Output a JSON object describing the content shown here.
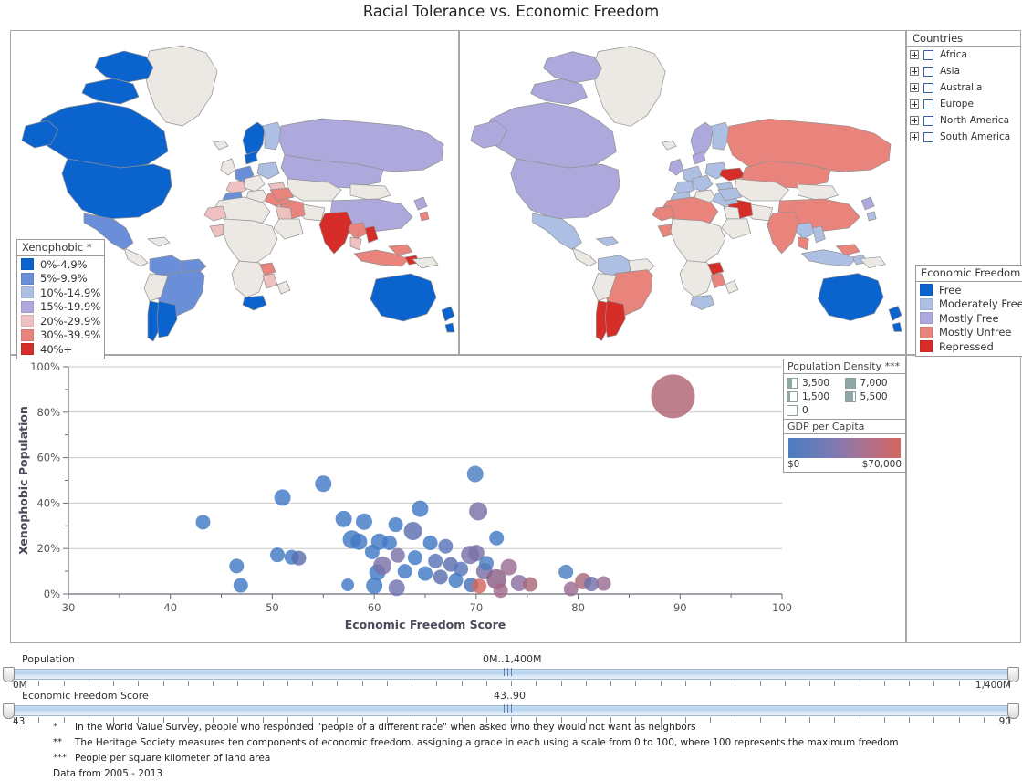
{
  "title": "Racial Tolerance vs. Economic Freedom",
  "countries_panel": {
    "header": "Countries",
    "items": [
      {
        "label": "Africa",
        "expander": "+",
        "checked": false
      },
      {
        "label": "Asia",
        "expander": "+",
        "checked": false
      },
      {
        "label": "Australia",
        "expander": "+",
        "checked": false
      },
      {
        "label": "Europe",
        "expander": "+",
        "checked": false
      },
      {
        "label": "North America",
        "expander": "+",
        "checked": false
      },
      {
        "label": "South America",
        "expander": "+",
        "checked": false
      }
    ]
  },
  "legend_xenophobic": {
    "title": "Xenophobic *",
    "items": [
      {
        "label": "0%-4.9%",
        "color": "#0b63ce"
      },
      {
        "label": "5%-9.9%",
        "color": "#6a8fd8"
      },
      {
        "label": "10%-14.9%",
        "color": "#aebfe4"
      },
      {
        "label": "15%-19.9%",
        "color": "#ada9dc"
      },
      {
        "label": "20%-29.9%",
        "color": "#eec0c0"
      },
      {
        "label": "30%-39.9%",
        "color": "#e8847c"
      },
      {
        "label": "40%+",
        "color": "#d62d28"
      }
    ]
  },
  "legend_economic_freedom": {
    "title": "Economic Freedom **",
    "items": [
      {
        "label": "Free",
        "color": "#0b63ce"
      },
      {
        "label": "Moderately Free",
        "color": "#aebfe4"
      },
      {
        "label": "Mostly Free",
        "color": "#ada9dc"
      },
      {
        "label": "Mostly Unfree",
        "color": "#e8847c"
      },
      {
        "label": "Repressed",
        "color": "#d62d28"
      }
    ]
  },
  "legend_population_density": {
    "title": "Population Density ***",
    "items": [
      {
        "label": "3,500",
        "fill": 0.5
      },
      {
        "label": "7,000",
        "fill": 1.0
      },
      {
        "label": "1,500",
        "fill": 0.3
      },
      {
        "label": "5,500",
        "fill": 0.8
      },
      {
        "label": "0",
        "fill": 0.0
      }
    ]
  },
  "legend_gdp": {
    "title": "GDP per Capita",
    "min_label": "$0",
    "max_label": "$70,000",
    "min_color": "#4a7ec0",
    "max_color": "#d4655e"
  },
  "sliders": [
    {
      "name": "Population",
      "value": "0M..1,400M",
      "min": "0M",
      "max": "1,400M"
    },
    {
      "name": "Economic Freedom Score",
      "value": "43..90",
      "min": "43",
      "max": "90"
    }
  ],
  "footnotes": [
    {
      "mark": "*",
      "text": "In the World Value Survey, people who responded \"people of a different race\" when asked who they would not want as neighbors"
    },
    {
      "mark": "**",
      "text": "The Heritage Society measures ten components of economic freedom, assigning a grade in each using a scale from 0 to 100, where 100 represents the maximum freedom"
    },
    {
      "mark": "***",
      "text": "People per square kilometer of land area"
    }
  ],
  "data_note": "Data from 2005 - 2013",
  "chart_data": {
    "type": "scatter",
    "title": "Racial Tolerance vs. Economic Freedom",
    "xlabel": "Economic Freedom Score",
    "ylabel": "Xenophobic Population",
    "xlim": [
      30,
      100
    ],
    "ylim": [
      0,
      1
    ],
    "xticks": [
      30,
      40,
      50,
      60,
      70,
      80,
      90,
      100
    ],
    "yticks": [
      0,
      20,
      40,
      60,
      80,
      100
    ],
    "ytick_labels": [
      "0%",
      "20%",
      "40%",
      "60%",
      "80%",
      "100%"
    ],
    "grid": "horizontal",
    "size_encodes": "Population Density (people per sq km)",
    "color_encodes": "GDP per Capita ($0 - $70,000)",
    "points": [
      {
        "x": 89.3,
        "y": 87.0,
        "r": 24,
        "c": "#b06374"
      },
      {
        "x": 69.9,
        "y": 52.8,
        "r": 9,
        "c": "#4a7ec0"
      },
      {
        "x": 55.0,
        "y": 48.5,
        "r": 9,
        "c": "#4279c4"
      },
      {
        "x": 51.0,
        "y": 42.4,
        "r": 9,
        "c": "#4279c4"
      },
      {
        "x": 70.2,
        "y": 36.4,
        "r": 10,
        "c": "#7a72a8"
      },
      {
        "x": 64.5,
        "y": 37.5,
        "r": 9,
        "c": "#4279c4"
      },
      {
        "x": 43.2,
        "y": 31.6,
        "r": 8,
        "c": "#4279c4"
      },
      {
        "x": 57.0,
        "y": 33.0,
        "r": 9,
        "c": "#4279c4"
      },
      {
        "x": 59.0,
        "y": 31.8,
        "r": 9,
        "c": "#4279c4"
      },
      {
        "x": 62.1,
        "y": 30.5,
        "r": 8,
        "c": "#4279c4"
      },
      {
        "x": 63.8,
        "y": 27.7,
        "r": 10,
        "c": "#5d6fae"
      },
      {
        "x": 72.0,
        "y": 24.6,
        "r": 8,
        "c": "#4279c4"
      },
      {
        "x": 57.8,
        "y": 24.0,
        "r": 10,
        "c": "#4279c4"
      },
      {
        "x": 58.5,
        "y": 23.0,
        "r": 9,
        "c": "#4279c4"
      },
      {
        "x": 60.5,
        "y": 23.0,
        "r": 9,
        "c": "#4279c4"
      },
      {
        "x": 61.5,
        "y": 22.5,
        "r": 8,
        "c": "#4279c4"
      },
      {
        "x": 65.5,
        "y": 22.5,
        "r": 8,
        "c": "#4279c4"
      },
      {
        "x": 67.0,
        "y": 21.0,
        "r": 8,
        "c": "#5875b8"
      },
      {
        "x": 69.4,
        "y": 17.2,
        "r": 10,
        "c": "#7a72a8"
      },
      {
        "x": 50.5,
        "y": 17.2,
        "r": 8,
        "c": "#4279c4"
      },
      {
        "x": 51.9,
        "y": 16.2,
        "r": 8,
        "c": "#4279c4"
      },
      {
        "x": 52.6,
        "y": 15.8,
        "r": 8,
        "c": "#5d6fae"
      },
      {
        "x": 59.8,
        "y": 18.5,
        "r": 8,
        "c": "#4279c4"
      },
      {
        "x": 62.3,
        "y": 17.0,
        "r": 8,
        "c": "#7a72a8"
      },
      {
        "x": 64.0,
        "y": 16.0,
        "r": 8,
        "c": "#4279c4"
      },
      {
        "x": 66.0,
        "y": 14.5,
        "r": 8,
        "c": "#5875b8"
      },
      {
        "x": 67.5,
        "y": 13.0,
        "r": 8,
        "c": "#5d6fae"
      },
      {
        "x": 68.5,
        "y": 11.0,
        "r": 8,
        "c": "#5875b8"
      },
      {
        "x": 46.5,
        "y": 12.3,
        "r": 8,
        "c": "#4279c4"
      },
      {
        "x": 46.9,
        "y": 3.8,
        "r": 8,
        "c": "#4279c4"
      },
      {
        "x": 57.4,
        "y": 4.0,
        "r": 7,
        "c": "#4279c4"
      },
      {
        "x": 60.0,
        "y": 3.6,
        "r": 9,
        "c": "#4279c4"
      },
      {
        "x": 60.3,
        "y": 9.5,
        "r": 9,
        "c": "#4279c4"
      },
      {
        "x": 60.8,
        "y": 12.5,
        "r": 10,
        "c": "#7a72a8"
      },
      {
        "x": 62.2,
        "y": 2.7,
        "r": 9,
        "c": "#6e71ac"
      },
      {
        "x": 63.0,
        "y": 10.0,
        "r": 8,
        "c": "#4279c4"
      },
      {
        "x": 65.0,
        "y": 9.0,
        "r": 8,
        "c": "#4279c4"
      },
      {
        "x": 66.5,
        "y": 7.5,
        "r": 8,
        "c": "#5d6fae"
      },
      {
        "x": 68.0,
        "y": 6.0,
        "r": 8,
        "c": "#4279c4"
      },
      {
        "x": 69.5,
        "y": 4.0,
        "r": 8,
        "c": "#4a6fb4"
      },
      {
        "x": 70.3,
        "y": 3.5,
        "r": 8,
        "c": "#d4655e"
      },
      {
        "x": 70.8,
        "y": 10.0,
        "r": 9,
        "c": "#7a6ea4"
      },
      {
        "x": 72.0,
        "y": 6.5,
        "r": 11,
        "c": "#8a5f86"
      },
      {
        "x": 72.4,
        "y": 1.5,
        "r": 8,
        "c": "#a06a88"
      },
      {
        "x": 73.2,
        "y": 11.8,
        "r": 9,
        "c": "#9a6c92"
      },
      {
        "x": 74.2,
        "y": 4.8,
        "r": 9,
        "c": "#8a6fa0"
      },
      {
        "x": 75.3,
        "y": 4.2,
        "r": 8,
        "c": "#a86878"
      },
      {
        "x": 78.8,
        "y": 9.7,
        "r": 8,
        "c": "#4a7ec0"
      },
      {
        "x": 79.3,
        "y": 2.2,
        "r": 8,
        "c": "#9a6c92"
      },
      {
        "x": 80.5,
        "y": 5.6,
        "r": 9,
        "c": "#a86878"
      },
      {
        "x": 81.3,
        "y": 4.4,
        "r": 8,
        "c": "#6e71ac"
      },
      {
        "x": 82.5,
        "y": 4.6,
        "r": 8,
        "c": "#9a6c92"
      },
      {
        "x": 70.0,
        "y": 18.0,
        "r": 9,
        "c": "#7a72a8"
      },
      {
        "x": 71.0,
        "y": 13.5,
        "r": 8,
        "c": "#4a7ec0"
      }
    ]
  }
}
